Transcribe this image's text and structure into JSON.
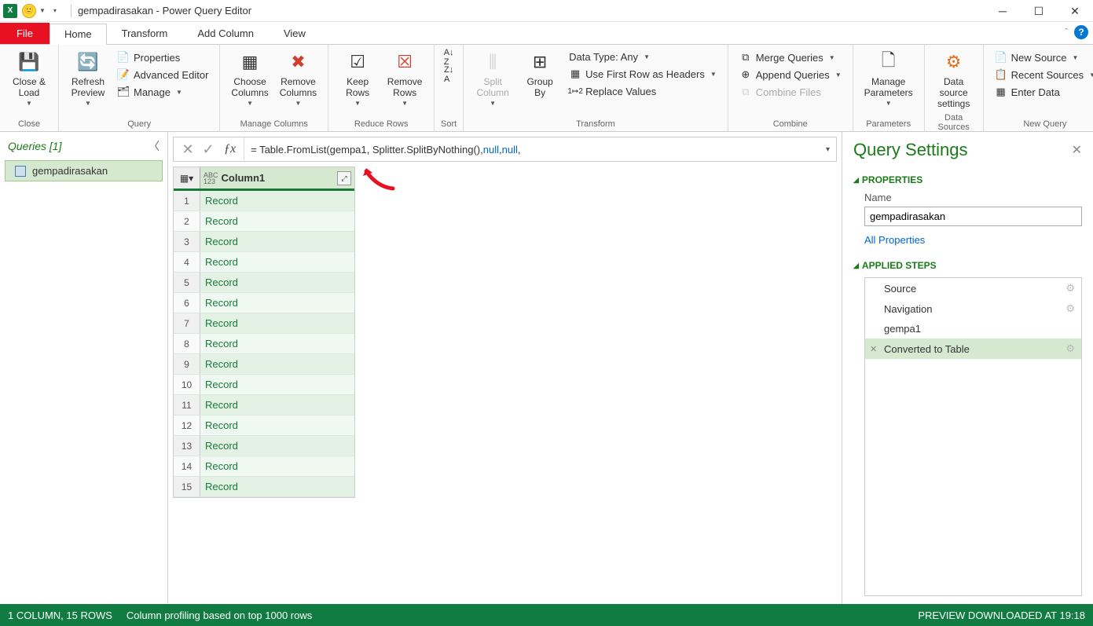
{
  "titlebar": {
    "title": "gempadirasakan - Power Query Editor"
  },
  "tabs": {
    "file": "File",
    "home": "Home",
    "transform": "Transform",
    "addcolumn": "Add Column",
    "view": "View"
  },
  "ribbon": {
    "close": {
      "close_load": "Close &\nLoad",
      "group": "Close"
    },
    "query": {
      "refresh": "Refresh\nPreview",
      "properties": "Properties",
      "advanced": "Advanced Editor",
      "manage": "Manage",
      "group": "Query"
    },
    "managecols": {
      "choose": "Choose\nColumns",
      "remove": "Remove\nColumns",
      "group": "Manage Columns"
    },
    "reduce": {
      "keep": "Keep\nRows",
      "remove": "Remove\nRows",
      "group": "Reduce Rows"
    },
    "sort": {
      "group": "Sort"
    },
    "transform": {
      "split": "Split\nColumn",
      "group_by": "Group\nBy",
      "datatype": "Data Type: Any",
      "firstrow": "Use First Row as Headers",
      "replace": "Replace Values",
      "group": "Transform"
    },
    "combine": {
      "merge": "Merge Queries",
      "append": "Append Queries",
      "files": "Combine Files",
      "group": "Combine"
    },
    "params": {
      "manage": "Manage\nParameters",
      "group": "Parameters"
    },
    "ds": {
      "settings": "Data source\nsettings",
      "group": "Data Sources"
    },
    "newq": {
      "new": "New Source",
      "recent": "Recent Sources",
      "enter": "Enter Data",
      "group": "New Query"
    }
  },
  "queries": {
    "header": "Queries [1]",
    "item": "gempadirasakan"
  },
  "formula": {
    "prefix": "= Table.FromList(gempa1, Splitter.SplitByNothing(), ",
    "null1": "null",
    "sep": ", ",
    "null2": "null",
    "suffix": ","
  },
  "grid": {
    "column": "Column1",
    "type_label": "ABC\n123",
    "rows": [
      "Record",
      "Record",
      "Record",
      "Record",
      "Record",
      "Record",
      "Record",
      "Record",
      "Record",
      "Record",
      "Record",
      "Record",
      "Record",
      "Record",
      "Record"
    ]
  },
  "settings": {
    "title": "Query Settings",
    "properties": "PROPERTIES",
    "name_label": "Name",
    "name_value": "gempadirasakan",
    "all_props": "All Properties",
    "applied": "APPLIED STEPS",
    "steps": [
      {
        "label": "Source",
        "gear": true
      },
      {
        "label": "Navigation",
        "gear": true
      },
      {
        "label": "gempa1",
        "gear": false
      },
      {
        "label": "Converted to Table",
        "gear": true,
        "active": true,
        "del": true
      }
    ]
  },
  "status": {
    "cols": "1 COLUMN, 15 ROWS",
    "profiling": "Column profiling based on top 1000 rows",
    "preview": "PREVIEW DOWNLOADED AT 19:18"
  }
}
